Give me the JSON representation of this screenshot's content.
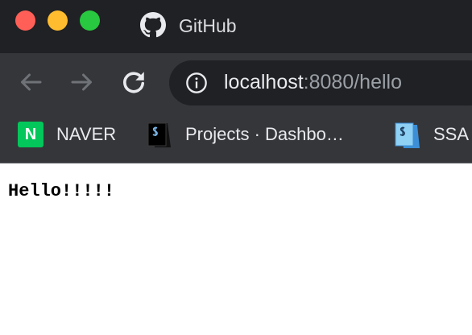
{
  "tab": {
    "title": "GitHub",
    "favicon": "github-icon"
  },
  "toolbar": {
    "back_icon": "back-arrow-icon",
    "forward_icon": "forward-arrow-icon",
    "reload_icon": "reload-icon"
  },
  "omnibox": {
    "info_icon": "info-icon",
    "url_host": "localhost",
    "url_rest": ":8080/hello"
  },
  "bookmarks": {
    "items": [
      {
        "label": "NAVER",
        "favicon_text": "N",
        "icon": "naver-icon",
        "color": "#03c75a"
      },
      {
        "label": "Projects · Dashbo…",
        "icon": "projects-icon"
      },
      {
        "label": "SSA",
        "icon": "ssa-icon"
      }
    ]
  },
  "page": {
    "text": "Hello!!!!!"
  },
  "colors": {
    "titlebar": "#202124",
    "toolbar": "#35363a",
    "traffic_red": "#ff5f57",
    "traffic_yellow": "#febc2e",
    "traffic_green": "#28c840"
  }
}
